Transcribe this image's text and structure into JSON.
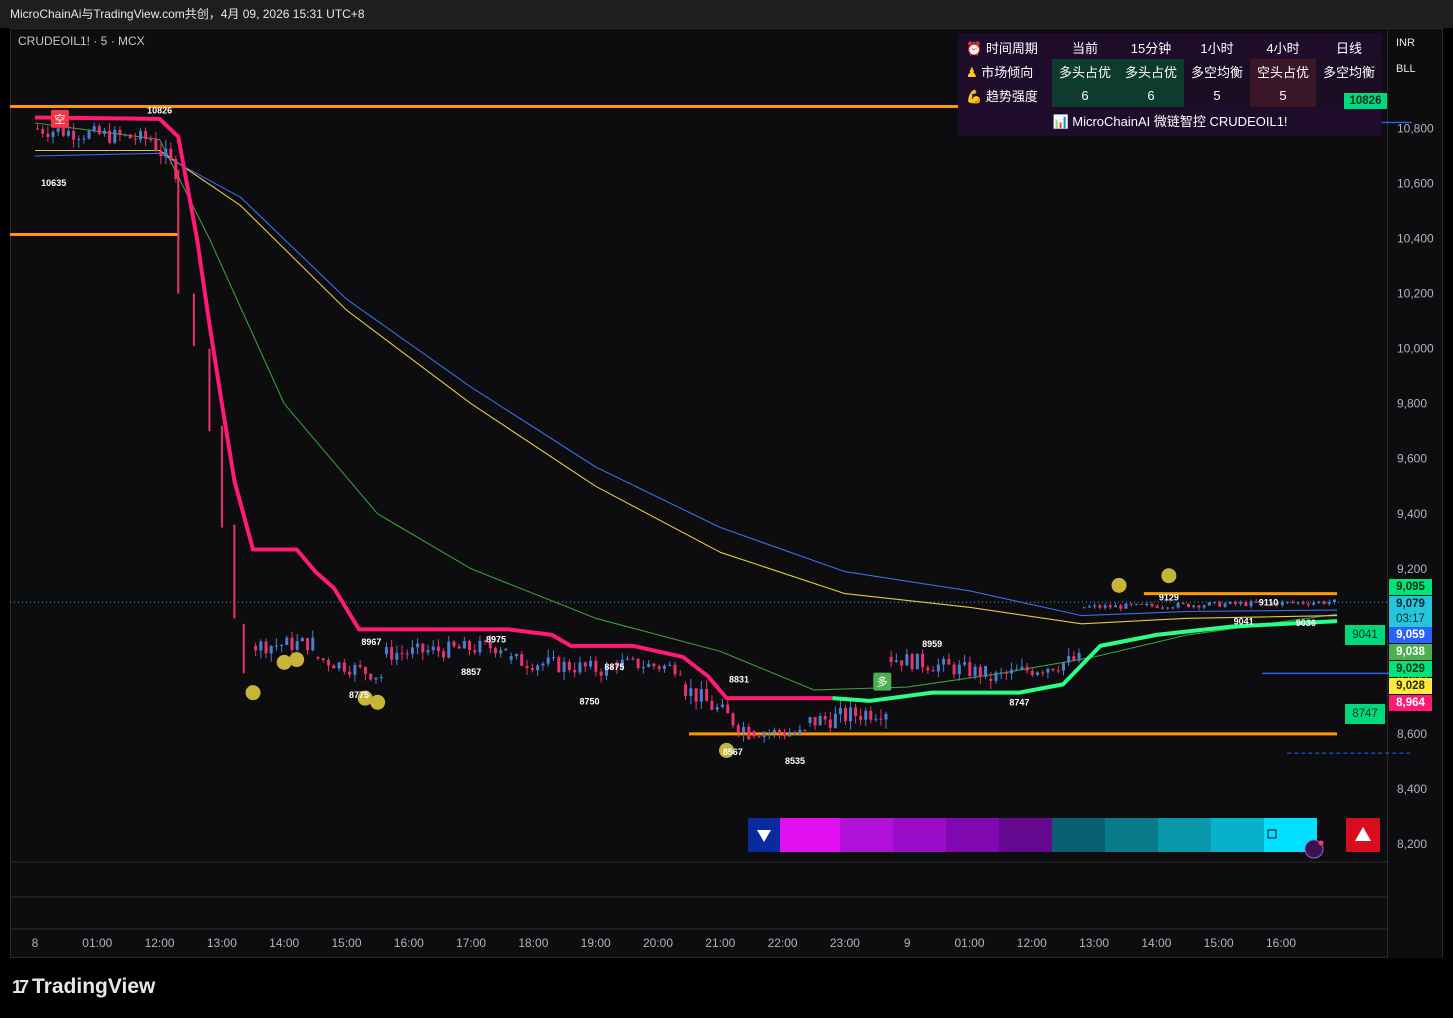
{
  "window": {
    "title": "MicroChainAi与TradingView.com共创，4月 09, 2026 15:31 UTC+8",
    "symbol": "CRUDEOIL1! · 5 · MCX",
    "brand": "TradingView"
  },
  "price_scale": {
    "currency": "INR",
    "unit": "BLL"
  },
  "dashboard": {
    "headers": {
      "label": "时间周期",
      "cols": [
        "当前",
        "15分钟",
        "1小时",
        "4小时",
        "日线"
      ]
    },
    "trend_row": {
      "label": "市场倾向",
      "cols": [
        "多头占优",
        "多头占优",
        "多空均衡",
        "空头占优",
        "多空均衡"
      ]
    },
    "strength_row": {
      "label": "趋势强度",
      "cols": [
        "6",
        "6",
        "5",
        "5",
        ""
      ]
    },
    "footer": "MicroChainAI 微链智控 CRUDEOIL1!"
  },
  "price_labels": [
    {
      "value": "10826",
      "color": "#00d97e"
    },
    {
      "value": "9,095",
      "color": "#00e676"
    },
    {
      "value": "9,079",
      "color": "#26c6da"
    },
    {
      "value": "03:17",
      "color": "#26c6da"
    },
    {
      "value": "9,059",
      "color": "#2962ff"
    },
    {
      "value": "9,038",
      "color": "#4caf50"
    },
    {
      "value": "9,029",
      "color": "#00e676"
    },
    {
      "value": "9,028",
      "color": "#ffeb3b"
    },
    {
      "value": "8,964",
      "color": "#ff1a75"
    }
  ],
  "side_tags": [
    "9041",
    "8747"
  ],
  "chart_data": {
    "type": "candlestick",
    "title": "CRUDEOIL1! · 5 · MCX",
    "y_ticks": [
      "10,800",
      "10,600",
      "10,400",
      "10,200",
      "10,000",
      "9,800",
      "9,600",
      "9,400",
      "9,200",
      "9,000",
      "8,800",
      "8,600",
      "8,400",
      "8,200"
    ],
    "y_tick_values": [
      10800,
      10600,
      10400,
      10200,
      10000,
      9800,
      9600,
      9400,
      9200,
      9000,
      8800,
      8600,
      8400,
      8200
    ],
    "ylim": [
      8160,
      11080
    ],
    "x_ticks": [
      "8",
      "01:00",
      "12:00",
      "13:00",
      "14:00",
      "15:00",
      "16:00",
      "17:00",
      "18:00",
      "19:00",
      "20:00",
      "21:00",
      "22:00",
      "23:00",
      "9",
      "01:00",
      "12:00",
      "13:00",
      "14:00",
      "15:00",
      "16:00"
    ],
    "price_annotations": [
      {
        "label": "10826",
        "price": 10826,
        "t": 2
      },
      {
        "label": "10635",
        "price": 10635,
        "t": 0.3
      },
      {
        "label": "8967",
        "price": 8967,
        "t": 5.4
      },
      {
        "label": "8975",
        "price": 8975,
        "t": 7.4
      },
      {
        "label": "8857",
        "price": 8857,
        "t": 7
      },
      {
        "label": "8775",
        "price": 8775,
        "t": 5.2
      },
      {
        "label": "8875",
        "price": 8875,
        "t": 9.3
      },
      {
        "label": "8750",
        "price": 8750,
        "t": 8.9
      },
      {
        "label": "8831",
        "price": 8831,
        "t": 11.3
      },
      {
        "label": "8567",
        "price": 8567,
        "t": 11.2
      },
      {
        "label": "8535",
        "price": 8535,
        "t": 12.2
      },
      {
        "label": "8959",
        "price": 8959,
        "t": 14.4
      },
      {
        "label": "8747",
        "price": 8747,
        "t": 15.8
      },
      {
        "label": "9129",
        "price": 9129,
        "t": 18.2
      },
      {
        "label": "9110",
        "price": 9110,
        "t": 19.8
      },
      {
        "label": "9041",
        "price": 9041,
        "t": 19.4
      },
      {
        "label": "9036",
        "price": 9036,
        "t": 20.4
      }
    ],
    "signals": [
      {
        "label": "空",
        "t": 0.4,
        "price": 10835,
        "color": "#f23645"
      },
      {
        "label": "多",
        "t": 13.6,
        "price": 8790,
        "color": "#4caf50"
      }
    ],
    "support_resistance": [
      {
        "price": 10880,
        "t_start": 0,
        "t_end": 16.8,
        "color": "#ff9800"
      },
      {
        "price": 10415,
        "t_start": 0,
        "t_end": 2.3,
        "color": "#ff9800"
      },
      {
        "price": 8600,
        "t_start": 10.9,
        "t_end": 20.9,
        "color": "#ff9800"
      },
      {
        "price": 9110,
        "t_start": 18.2,
        "t_end": 20.9,
        "color": "#ff9800"
      },
      {
        "price": 8820,
        "t_start": 20.1,
        "t_end": 22.1,
        "color": "#2962ff"
      },
      {
        "price": 10822,
        "t_start": 19.4,
        "t_end": 22.1,
        "color": "#2962ff"
      }
    ],
    "supertrend": [
      [
        0,
        10840
      ],
      [
        2,
        10835
      ],
      [
        2.3,
        10770
      ],
      [
        2.6,
        10400
      ],
      [
        2.8,
        10090
      ],
      [
        3,
        9800
      ],
      [
        3.2,
        9520
      ],
      [
        3.5,
        9270
      ],
      [
        4.2,
        9270
      ],
      [
        4.5,
        9190
      ],
      [
        4.8,
        9130
      ],
      [
        5.2,
        8980
      ],
      [
        7.6,
        8980
      ],
      [
        8.3,
        8960
      ],
      [
        8.6,
        8920
      ],
      [
        9.6,
        8920
      ],
      [
        10.4,
        8880
      ],
      [
        10.8,
        8810
      ],
      [
        11.1,
        8730
      ],
      [
        12.8,
        8730
      ],
      [
        13.4,
        8720
      ],
      [
        14.4,
        8750
      ],
      [
        15.8,
        8750
      ],
      [
        16.5,
        8780
      ],
      [
        17.1,
        8920
      ],
      [
        18,
        8960
      ],
      [
        19.2,
        8990
      ],
      [
        20.9,
        9010
      ]
    ],
    "ma_blue": [
      [
        0,
        10700
      ],
      [
        2,
        10710
      ],
      [
        3.3,
        10550
      ],
      [
        5,
        10180
      ],
      [
        7,
        9860
      ],
      [
        9,
        9570
      ],
      [
        11,
        9350
      ],
      [
        13,
        9190
      ],
      [
        15,
        9120
      ],
      [
        16.8,
        9030
      ],
      [
        18.5,
        9045
      ],
      [
        20.9,
        9050
      ]
    ],
    "ma_yellow": [
      [
        0,
        10720
      ],
      [
        2,
        10720
      ],
      [
        3.3,
        10520
      ],
      [
        5,
        10140
      ],
      [
        7,
        9800
      ],
      [
        9,
        9500
      ],
      [
        11,
        9260
      ],
      [
        13,
        9110
      ],
      [
        15,
        9060
      ],
      [
        16.8,
        9000
      ],
      [
        18.5,
        9020
      ],
      [
        20.9,
        9030
      ]
    ],
    "ma_green": [
      [
        0,
        10820
      ],
      [
        2,
        10760
      ],
      [
        2.8,
        10400
      ],
      [
        4,
        9800
      ],
      [
        5.5,
        9400
      ],
      [
        7,
        9200
      ],
      [
        9,
        9020
      ],
      [
        11,
        8900
      ],
      [
        12.5,
        8760
      ],
      [
        14,
        8770
      ],
      [
        15.5,
        8820
      ],
      [
        17,
        8880
      ],
      [
        18.5,
        8960
      ],
      [
        20.9,
        9035
      ]
    ],
    "candles_segments": [
      {
        "t_start": 0,
        "t_end": 1.9,
        "start": 10800,
        "end": 10760,
        "vol": 60
      },
      {
        "t_start": 1.9,
        "t_end": 2.3,
        "start": 10760,
        "end": 10650,
        "vol": 70
      },
      {
        "t_start": 3.5,
        "t_end": 4.5,
        "start": 8920,
        "end": 8930,
        "vol": 60
      },
      {
        "t_start": 4.5,
        "t_end": 5.6,
        "start": 8880,
        "end": 8810,
        "vol": 55
      },
      {
        "t_start": 5.6,
        "t_end": 7.6,
        "start": 8890,
        "end": 8920,
        "vol": 60
      },
      {
        "t_start": 7.6,
        "t_end": 9.3,
        "start": 8870,
        "end": 8830,
        "vol": 60
      },
      {
        "t_start": 9.3,
        "t_end": 10.4,
        "start": 8860,
        "end": 8840,
        "vol": 50
      },
      {
        "t_start": 10.4,
        "t_end": 11.5,
        "start": 8780,
        "end": 8610,
        "vol": 70
      },
      {
        "t_start": 11.5,
        "t_end": 12.4,
        "start": 8610,
        "end": 8600,
        "vol": 50
      },
      {
        "t_start": 12.4,
        "t_end": 13.7,
        "start": 8640,
        "end": 8690,
        "vol": 70
      },
      {
        "t_start": 13.7,
        "t_end": 15.3,
        "start": 8880,
        "end": 8820,
        "vol": 60
      },
      {
        "t_start": 15.3,
        "t_end": 16.8,
        "start": 8800,
        "end": 8870,
        "vol": 60
      },
      {
        "t_start": 16.8,
        "t_end": 20.9,
        "start": 9060,
        "end": 9080,
        "vol": 20
      }
    ],
    "bubbles": [
      {
        "t": 3.5,
        "price": 8750
      },
      {
        "t": 4,
        "price": 8860
      },
      {
        "t": 4.2,
        "price": 8870
      },
      {
        "t": 5.3,
        "price": 8730
      },
      {
        "t": 5.5,
        "price": 8715
      },
      {
        "t": 11.1,
        "price": 8540
      },
      {
        "t": 17.4,
        "price": 9140
      },
      {
        "t": 18.2,
        "price": 9175
      }
    ],
    "current_price": 9079,
    "gradient_bar": [
      "#6a00d5",
      "#e010f0",
      "#b010d8",
      "#9a0cc8",
      "#8008b0",
      "#650890",
      "#0a6070",
      "#087a8a",
      "#0898aa",
      "#08b0cc",
      "#00e0ff"
    ],
    "grid": false,
    "legend": "top-right"
  }
}
